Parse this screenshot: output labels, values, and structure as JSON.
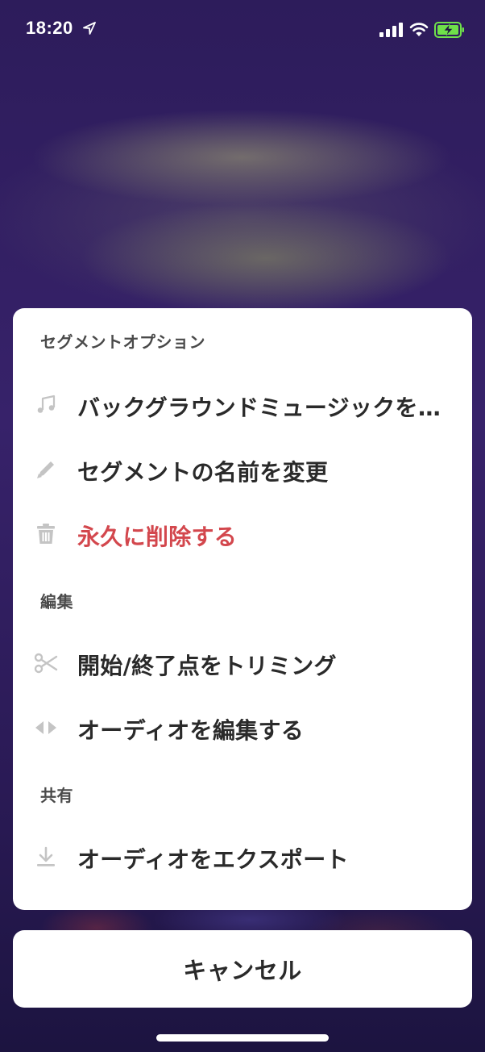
{
  "status_bar": {
    "time": "18:20",
    "icons": [
      "location-arrow-icon",
      "signal-bars-icon",
      "wifi-icon",
      "battery-charging-icon"
    ]
  },
  "sheet": {
    "sections": [
      {
        "header": "セグメントオプション",
        "items": [
          {
            "label": "バックグラウンドミュージックを…",
            "icon": "music-note-icon"
          },
          {
            "label": "セグメントの名前を変更",
            "icon": "pencil-icon"
          },
          {
            "label": "永久に削除する",
            "icon": "trash-icon",
            "destructive": true
          }
        ]
      },
      {
        "header": "編集",
        "items": [
          {
            "label": "開始/終了点をトリミング",
            "icon": "scissors-icon"
          },
          {
            "label": "オーディオを編集する",
            "icon": "left-right-arrows-icon"
          }
        ]
      },
      {
        "header": "共有",
        "items": [
          {
            "label": "オーディオをエクスポート",
            "icon": "download-icon"
          }
        ]
      }
    ]
  },
  "cancel_label": "キャンセル",
  "colors": {
    "destructive": "#d3474d",
    "icon_gray": "#c4c4c4",
    "text": "#2a2a2a",
    "battery_green": "#6fe04a"
  }
}
